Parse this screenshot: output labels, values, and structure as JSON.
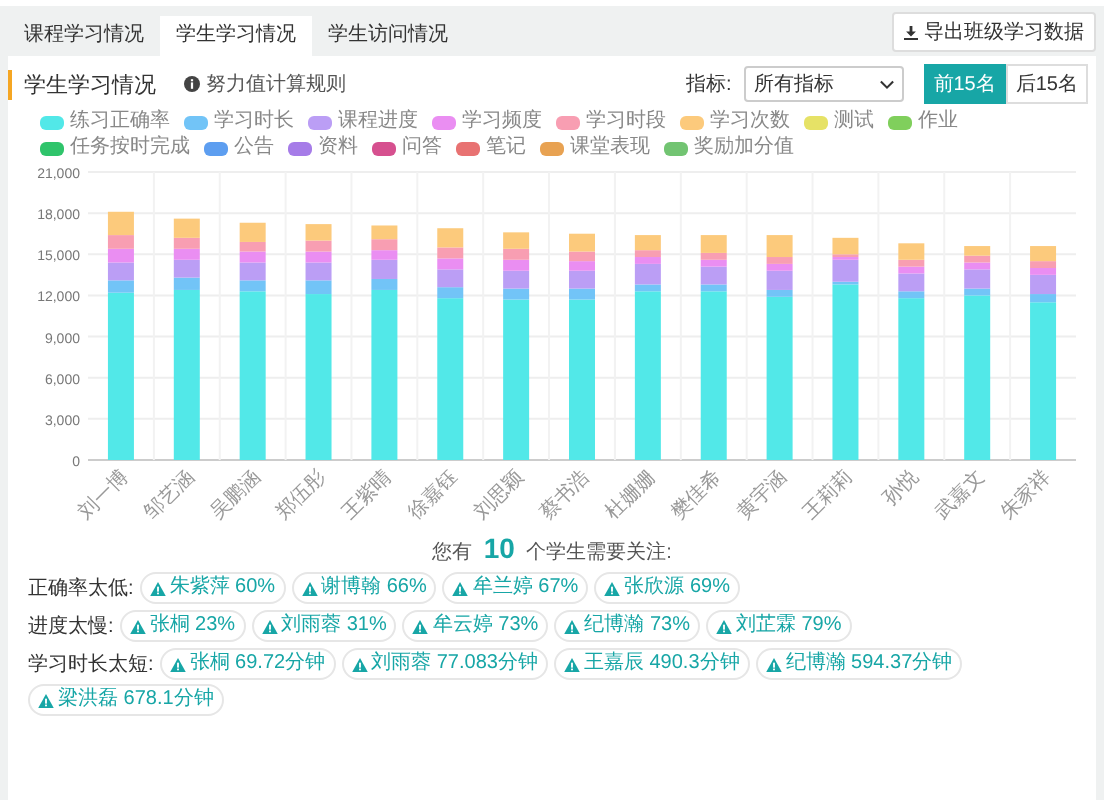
{
  "tabs": [
    {
      "label": "课程学习情况",
      "selected": false
    },
    {
      "label": "学生学习情况",
      "selected": true
    },
    {
      "label": "学生访问情况",
      "selected": false
    }
  ],
  "export_button": "导出班级学习数据",
  "panel": {
    "title": "学生学习情况",
    "rule_link": "努力值计算规则",
    "metric_label": "指标:",
    "metric_select": "所有指标",
    "rank_toggle": [
      {
        "label": "前15名",
        "selected": true
      },
      {
        "label": "后15名",
        "selected": false
      }
    ],
    "chart_data": {
      "type": "bar",
      "stacked": true,
      "grid": true,
      "categories": [
        "刘一博",
        "邹艺涵",
        "吴鹏涵",
        "郑伍彤",
        "王紫晴",
        "徐嘉钰",
        "刘思颖",
        "蔡书浩",
        "杜姗姗",
        "樊佳希",
        "黄宇涵",
        "王莉莉",
        "孙悦",
        "武嘉文",
        "朱家祥"
      ],
      "ylim": [
        0,
        21000
      ],
      "yticks": [
        {
          "value": 0,
          "label": "0"
        },
        {
          "value": 3000,
          "label": "3,000"
        },
        {
          "value": 6000,
          "label": "6,000"
        },
        {
          "value": 9000,
          "label": "9,000"
        },
        {
          "value": 12000,
          "label": "12,000"
        },
        {
          "value": 15000,
          "label": "15,000"
        },
        {
          "value": 18000,
          "label": "18,000"
        },
        {
          "value": 21000,
          "label": "21,000"
        }
      ],
      "series": [
        {
          "name": "练习正确率",
          "color": "#52e8e8",
          "values": [
            12200,
            12400,
            12300,
            12100,
            12400,
            11800,
            11700,
            11700,
            12300,
            12300,
            11900,
            12800,
            11800,
            12000,
            11500
          ]
        },
        {
          "name": "学习时长",
          "color": "#72c4f7",
          "values": [
            900,
            900,
            800,
            1000,
            800,
            800,
            800,
            800,
            500,
            500,
            500,
            200,
            500,
            500,
            600
          ]
        },
        {
          "name": "课程进度",
          "color": "#bb9ef5",
          "values": [
            1300,
            1300,
            1300,
            1300,
            1400,
            1300,
            1300,
            1300,
            1500,
            1300,
            1400,
            1600,
            1300,
            1400,
            1400
          ]
        },
        {
          "name": "学习频度",
          "color": "#ea8ef2",
          "values": [
            1000,
            800,
            800,
            800,
            700,
            800,
            800,
            700,
            500,
            500,
            500,
            200,
            500,
            500,
            500
          ]
        },
        {
          "name": "学习时段",
          "color": "#f89eb2",
          "values": [
            1000,
            800,
            700,
            800,
            800,
            800,
            800,
            700,
            500,
            500,
            500,
            200,
            500,
            500,
            500
          ]
        },
        {
          "name": "学习次数",
          "color": "#fcca7c",
          "values": [
            1700,
            1400,
            1400,
            1200,
            1000,
            1400,
            1200,
            1300,
            1100,
            1300,
            1600,
            1200,
            1200,
            700,
            1100
          ]
        },
        {
          "name": "测试",
          "color": "#e6e266",
          "values": [
            0,
            0,
            0,
            0,
            0,
            0,
            0,
            0,
            0,
            0,
            0,
            0,
            0,
            0,
            0
          ]
        },
        {
          "name": "作业",
          "color": "#80cf5c",
          "values": [
            0,
            0,
            0,
            0,
            0,
            0,
            0,
            0,
            0,
            0,
            0,
            0,
            0,
            0,
            0
          ]
        },
        {
          "name": "任务按时完成",
          "color": "#2fc46b",
          "values": [
            0,
            0,
            0,
            0,
            0,
            0,
            0,
            0,
            0,
            0,
            0,
            0,
            0,
            0,
            0
          ]
        },
        {
          "name": "公告",
          "color": "#5d9ef0",
          "values": [
            0,
            0,
            0,
            0,
            0,
            0,
            0,
            0,
            0,
            0,
            0,
            0,
            0,
            0,
            0
          ]
        },
        {
          "name": "资料",
          "color": "#a67ce8",
          "values": [
            0,
            0,
            0,
            0,
            0,
            0,
            0,
            0,
            0,
            0,
            0,
            0,
            0,
            0,
            0
          ]
        },
        {
          "name": "问答",
          "color": "#d6508f",
          "values": [
            0,
            0,
            0,
            0,
            0,
            0,
            0,
            0,
            0,
            0,
            0,
            0,
            0,
            0,
            0
          ]
        },
        {
          "name": "笔记",
          "color": "#e87272",
          "values": [
            0,
            0,
            0,
            0,
            0,
            0,
            0,
            0,
            0,
            0,
            0,
            0,
            0,
            0,
            0
          ]
        },
        {
          "name": "课堂表现",
          "color": "#e8a252",
          "values": [
            0,
            0,
            0,
            0,
            0,
            0,
            0,
            0,
            0,
            0,
            0,
            0,
            0,
            0,
            0
          ]
        },
        {
          "name": "奖励加分值",
          "color": "#72c472",
          "values": [
            0,
            0,
            0,
            0,
            0,
            0,
            0,
            0,
            0,
            0,
            0,
            0,
            0,
            0,
            0
          ]
        }
      ]
    }
  },
  "attention": {
    "prefix": "您有",
    "count": "10",
    "suffix": "个学生需要关注:",
    "groups": [
      {
        "label": "正确率太低:",
        "students": [
          "朱紫萍 60%",
          "谢博翰 66%",
          "牟兰婷 67%",
          "张欣源 69%"
        ]
      },
      {
        "label": "进度太慢:",
        "students": [
          "张桐 23%",
          "刘雨蓉 31%",
          "牟云婷 73%",
          "纪博瀚 73%",
          "刘芷霖 79%"
        ]
      },
      {
        "label": "学习时长太短:",
        "students": [
          "张桐 69.72分钟",
          "刘雨蓉 77.083分钟",
          "王嘉辰 490.3分钟",
          "纪博瀚 594.37分钟",
          "梁洪磊 678.1分钟"
        ]
      }
    ]
  }
}
